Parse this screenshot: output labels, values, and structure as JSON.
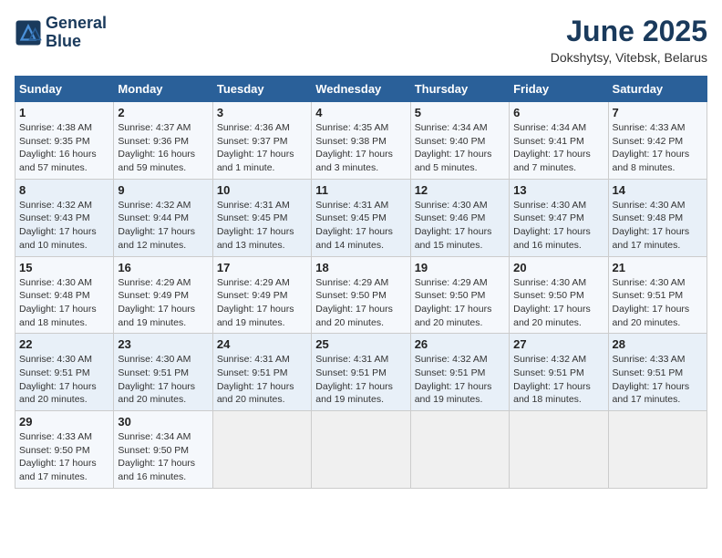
{
  "logo": {
    "line1": "General",
    "line2": "Blue"
  },
  "title": "June 2025",
  "subtitle": "Dokshytsy, Vitebsk, Belarus",
  "header_color": "#2a6099",
  "days_of_week": [
    "Sunday",
    "Monday",
    "Tuesday",
    "Wednesday",
    "Thursday",
    "Friday",
    "Saturday"
  ],
  "weeks": [
    [
      {
        "day": "1",
        "info": "Sunrise: 4:38 AM\nSunset: 9:35 PM\nDaylight: 16 hours\nand 57 minutes."
      },
      {
        "day": "2",
        "info": "Sunrise: 4:37 AM\nSunset: 9:36 PM\nDaylight: 16 hours\nand 59 minutes."
      },
      {
        "day": "3",
        "info": "Sunrise: 4:36 AM\nSunset: 9:37 PM\nDaylight: 17 hours\nand 1 minute."
      },
      {
        "day": "4",
        "info": "Sunrise: 4:35 AM\nSunset: 9:38 PM\nDaylight: 17 hours\nand 3 minutes."
      },
      {
        "day": "5",
        "info": "Sunrise: 4:34 AM\nSunset: 9:40 PM\nDaylight: 17 hours\nand 5 minutes."
      },
      {
        "day": "6",
        "info": "Sunrise: 4:34 AM\nSunset: 9:41 PM\nDaylight: 17 hours\nand 7 minutes."
      },
      {
        "day": "7",
        "info": "Sunrise: 4:33 AM\nSunset: 9:42 PM\nDaylight: 17 hours\nand 8 minutes."
      }
    ],
    [
      {
        "day": "8",
        "info": "Sunrise: 4:32 AM\nSunset: 9:43 PM\nDaylight: 17 hours\nand 10 minutes."
      },
      {
        "day": "9",
        "info": "Sunrise: 4:32 AM\nSunset: 9:44 PM\nDaylight: 17 hours\nand 12 minutes."
      },
      {
        "day": "10",
        "info": "Sunrise: 4:31 AM\nSunset: 9:45 PM\nDaylight: 17 hours\nand 13 minutes."
      },
      {
        "day": "11",
        "info": "Sunrise: 4:31 AM\nSunset: 9:45 PM\nDaylight: 17 hours\nand 14 minutes."
      },
      {
        "day": "12",
        "info": "Sunrise: 4:30 AM\nSunset: 9:46 PM\nDaylight: 17 hours\nand 15 minutes."
      },
      {
        "day": "13",
        "info": "Sunrise: 4:30 AM\nSunset: 9:47 PM\nDaylight: 17 hours\nand 16 minutes."
      },
      {
        "day": "14",
        "info": "Sunrise: 4:30 AM\nSunset: 9:48 PM\nDaylight: 17 hours\nand 17 minutes."
      }
    ],
    [
      {
        "day": "15",
        "info": "Sunrise: 4:30 AM\nSunset: 9:48 PM\nDaylight: 17 hours\nand 18 minutes."
      },
      {
        "day": "16",
        "info": "Sunrise: 4:29 AM\nSunset: 9:49 PM\nDaylight: 17 hours\nand 19 minutes."
      },
      {
        "day": "17",
        "info": "Sunrise: 4:29 AM\nSunset: 9:49 PM\nDaylight: 17 hours\nand 19 minutes."
      },
      {
        "day": "18",
        "info": "Sunrise: 4:29 AM\nSunset: 9:50 PM\nDaylight: 17 hours\nand 20 minutes."
      },
      {
        "day": "19",
        "info": "Sunrise: 4:29 AM\nSunset: 9:50 PM\nDaylight: 17 hours\nand 20 minutes."
      },
      {
        "day": "20",
        "info": "Sunrise: 4:30 AM\nSunset: 9:50 PM\nDaylight: 17 hours\nand 20 minutes."
      },
      {
        "day": "21",
        "info": "Sunrise: 4:30 AM\nSunset: 9:51 PM\nDaylight: 17 hours\nand 20 minutes."
      }
    ],
    [
      {
        "day": "22",
        "info": "Sunrise: 4:30 AM\nSunset: 9:51 PM\nDaylight: 17 hours\nand 20 minutes."
      },
      {
        "day": "23",
        "info": "Sunrise: 4:30 AM\nSunset: 9:51 PM\nDaylight: 17 hours\nand 20 minutes."
      },
      {
        "day": "24",
        "info": "Sunrise: 4:31 AM\nSunset: 9:51 PM\nDaylight: 17 hours\nand 20 minutes."
      },
      {
        "day": "25",
        "info": "Sunrise: 4:31 AM\nSunset: 9:51 PM\nDaylight: 17 hours\nand 19 minutes."
      },
      {
        "day": "26",
        "info": "Sunrise: 4:32 AM\nSunset: 9:51 PM\nDaylight: 17 hours\nand 19 minutes."
      },
      {
        "day": "27",
        "info": "Sunrise: 4:32 AM\nSunset: 9:51 PM\nDaylight: 17 hours\nand 18 minutes."
      },
      {
        "day": "28",
        "info": "Sunrise: 4:33 AM\nSunset: 9:51 PM\nDaylight: 17 hours\nand 17 minutes."
      }
    ],
    [
      {
        "day": "29",
        "info": "Sunrise: 4:33 AM\nSunset: 9:50 PM\nDaylight: 17 hours\nand 17 minutes."
      },
      {
        "day": "30",
        "info": "Sunrise: 4:34 AM\nSunset: 9:50 PM\nDaylight: 17 hours\nand 16 minutes."
      },
      {
        "day": "",
        "info": ""
      },
      {
        "day": "",
        "info": ""
      },
      {
        "day": "",
        "info": ""
      },
      {
        "day": "",
        "info": ""
      },
      {
        "day": "",
        "info": ""
      }
    ]
  ]
}
